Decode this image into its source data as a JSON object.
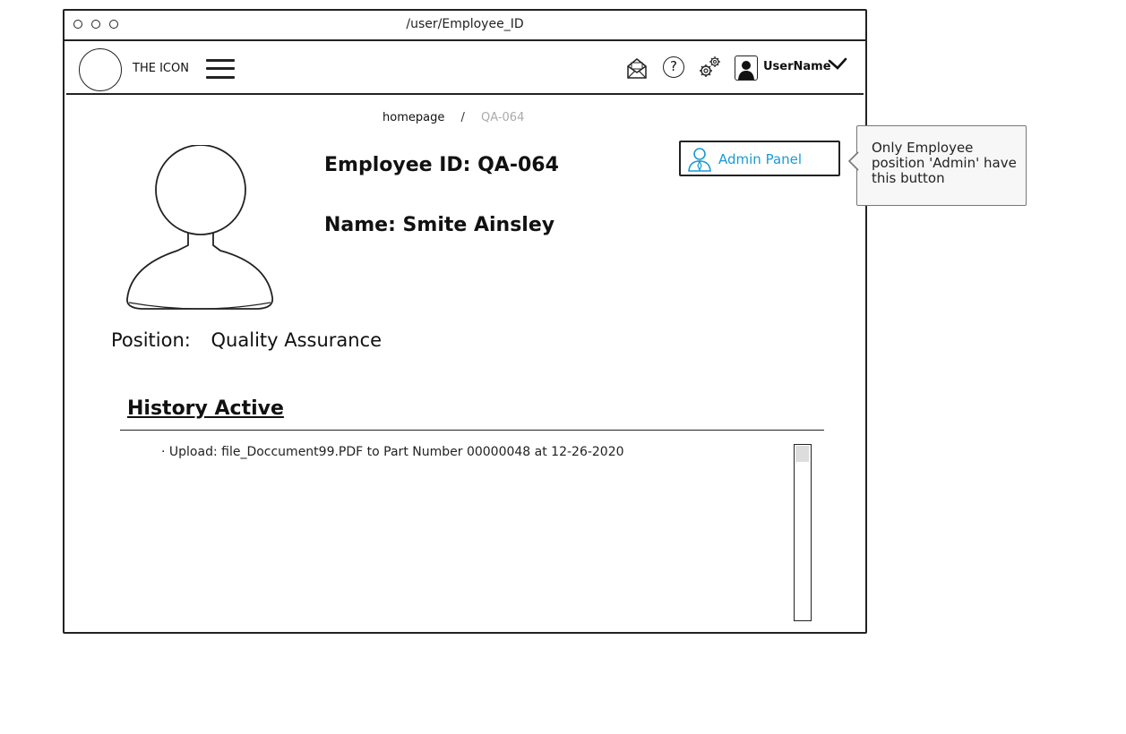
{
  "window": {
    "url": "/user/Employee_ID"
  },
  "navbar": {
    "logo_text": "THE ICON",
    "username": "UserName",
    "icons": {
      "menu": "hamburger-icon",
      "mail": "mail-open-icon",
      "help": "help-icon",
      "settings": "gear-icon",
      "user": "user-icon",
      "dropdown": "chevron-down-icon"
    },
    "help_glyph": "?"
  },
  "breadcrumb": {
    "home": "homepage",
    "separator": "/",
    "current": "QA-064"
  },
  "profile": {
    "employee_id": "Employee ID: QA-064",
    "name": "Name: Smite Ainsley",
    "position_label": "Position:",
    "position_value": "Quality Assurance"
  },
  "admin": {
    "button_label": "Admin Panel",
    "accent_color": "#1a9ad6"
  },
  "callout": {
    "text": "Only Employee position 'Admin' have this button"
  },
  "history": {
    "title": "History Active",
    "items": [
      "· Upload: file_Doccument99.PDF to Part Number 00000048 at 12-26-2020"
    ]
  }
}
